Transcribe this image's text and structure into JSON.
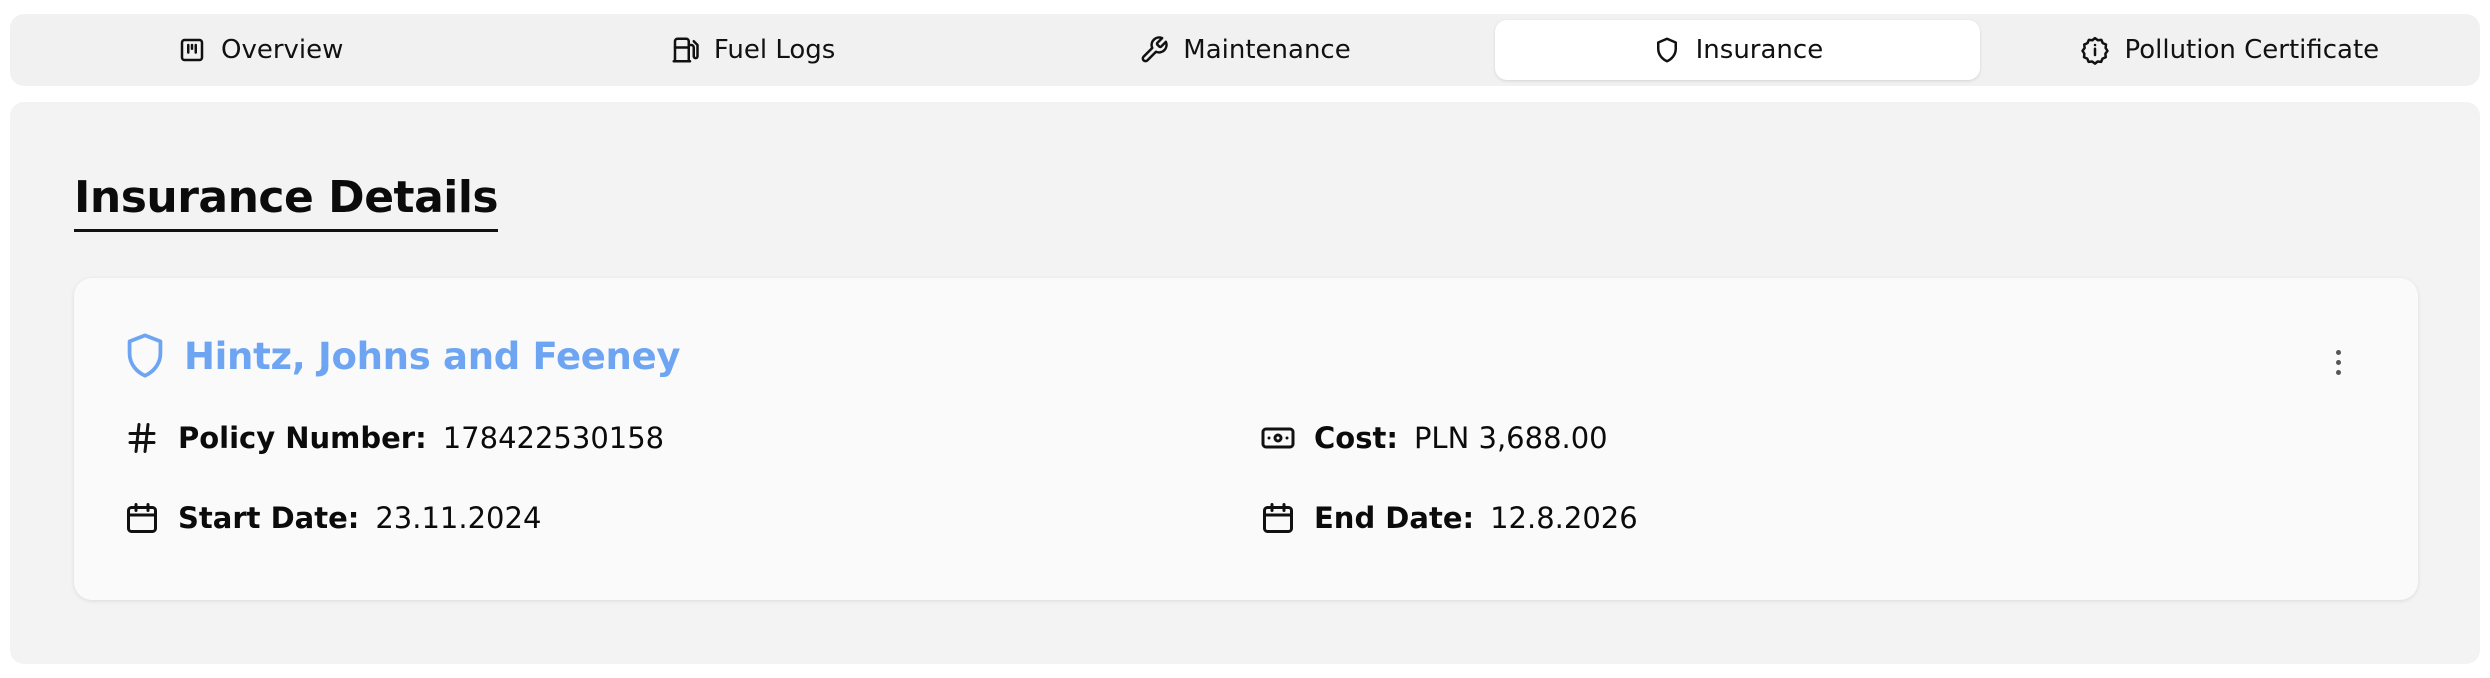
{
  "tabs": [
    {
      "label": "Overview",
      "icon": "overview-icon"
    },
    {
      "label": "Fuel Logs",
      "icon": "fuel-pump-icon"
    },
    {
      "label": "Maintenance",
      "icon": "wrench-icon"
    },
    {
      "label": "Insurance",
      "icon": "shield-icon",
      "active": true
    },
    {
      "label": "Pollution Certificate",
      "icon": "info-badge-icon"
    }
  ],
  "section": {
    "title": "Insurance Details"
  },
  "insurance": {
    "company": "Hintz, Johns and Feeney",
    "policy_label": "Policy Number:",
    "policy_value": "178422530158",
    "cost_label": "Cost:",
    "cost_value": "PLN 3,688.00",
    "start_label": "Start Date:",
    "start_value": "23.11.2024",
    "end_label": "End Date:",
    "end_value": "12.8.2026"
  },
  "colors": {
    "accent": "#6ea5f3",
    "panel_bg": "#f3f3f3",
    "card_bg": "#fafafa"
  }
}
